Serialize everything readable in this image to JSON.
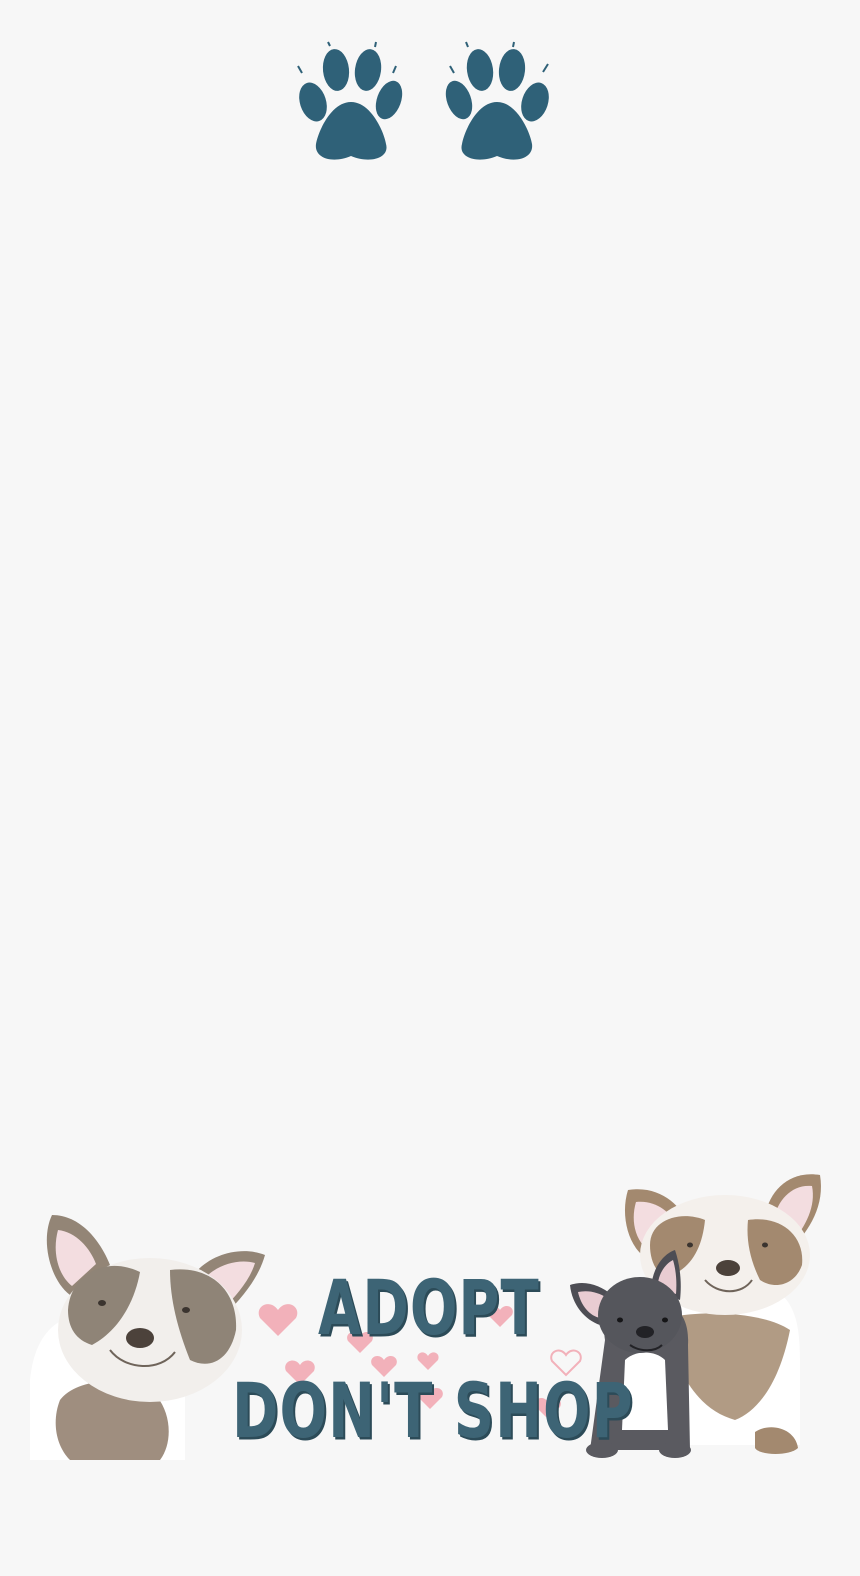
{
  "slogan": {
    "line1": "ADOPT",
    "line2": "DON'T SHOP"
  },
  "icons": {
    "paw_left": "paw-print-icon",
    "paw_right": "paw-print-icon"
  },
  "colors": {
    "background": "#f7f7f7",
    "accent": "#3d6475",
    "heart": "#f19aa6"
  }
}
